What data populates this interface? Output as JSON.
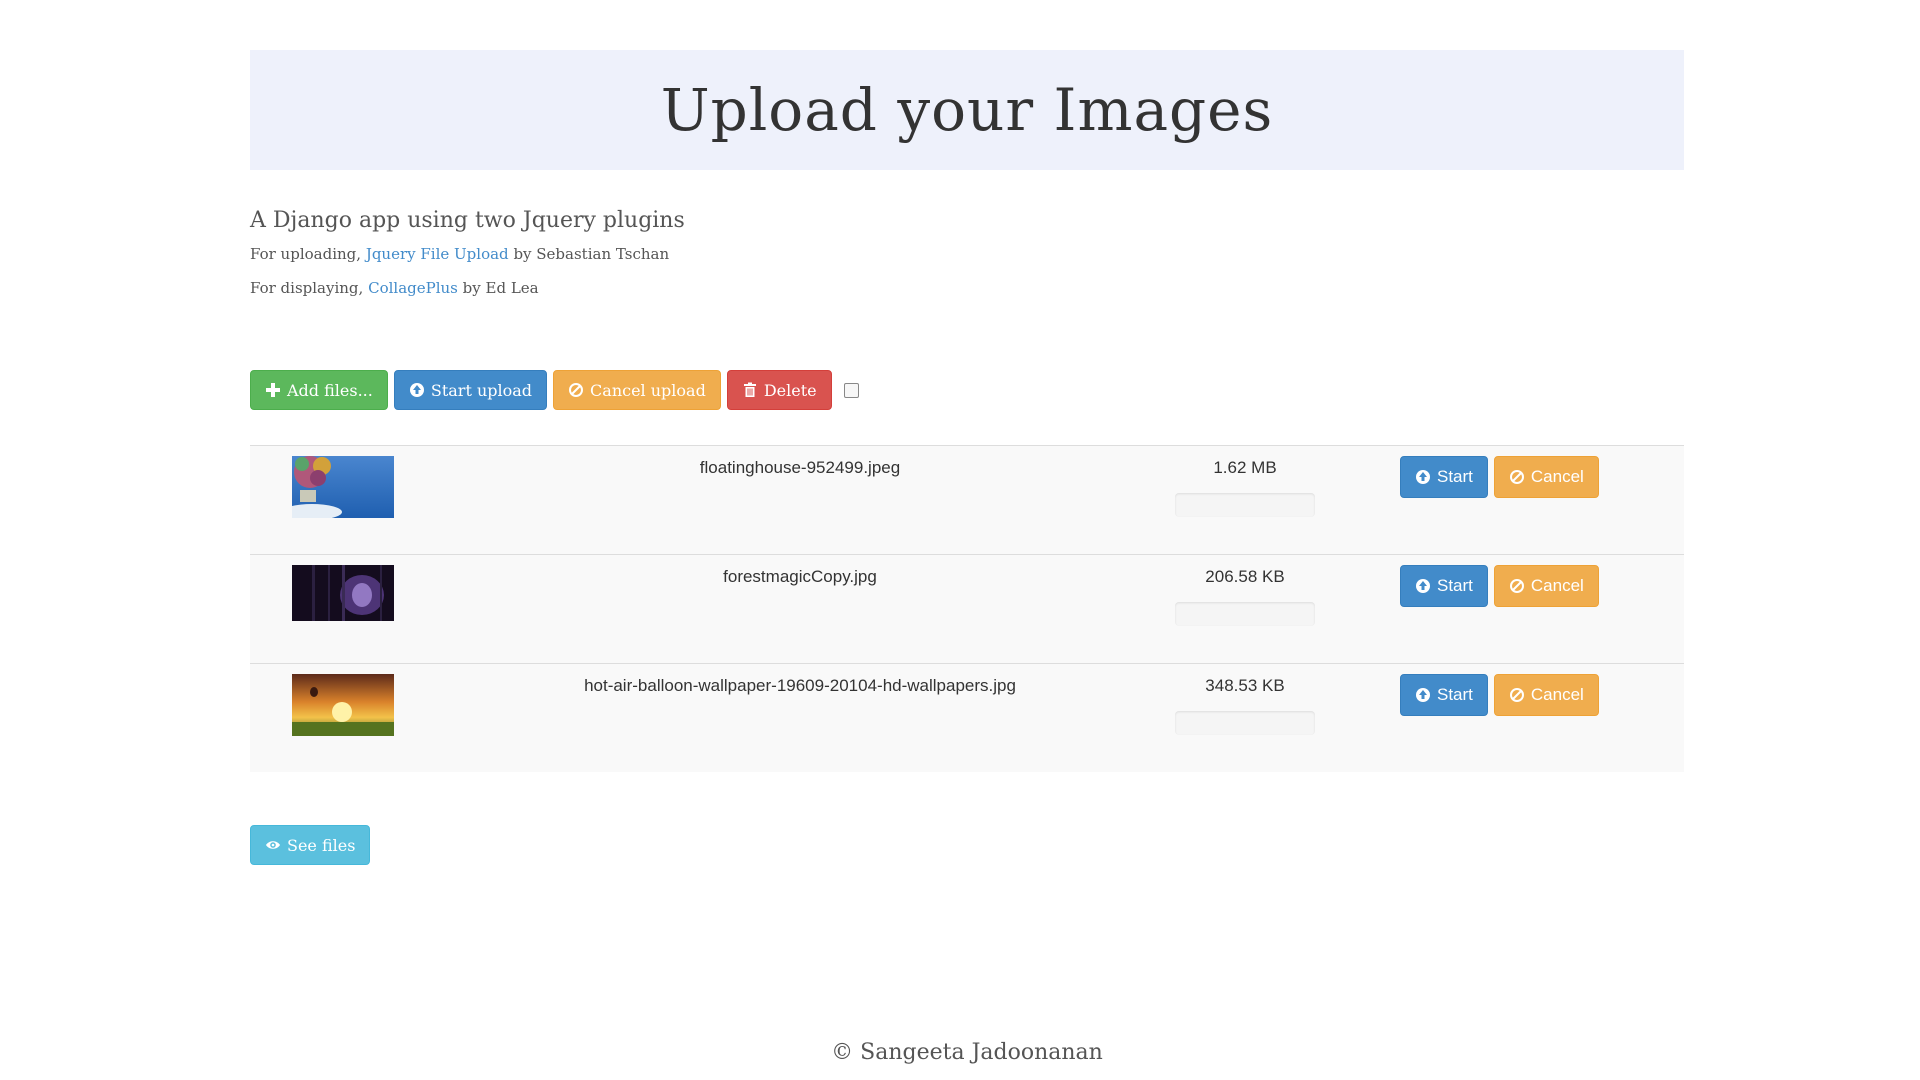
{
  "header": {
    "title": "Upload your Images"
  },
  "intro": {
    "heading": "A Django app using two Jquery plugins",
    "line1": {
      "prefix": "For uploading,",
      "link": "Jquery File Upload",
      "suffix": "by Sebastian Tschan"
    },
    "line2": {
      "prefix": "For displaying,",
      "link": "CollagePlus",
      "suffix": "by Ed Lea"
    }
  },
  "toolbar": {
    "add_label": "Add files...",
    "start_label": "Start upload",
    "cancel_label": "Cancel upload",
    "delete_label": "Delete"
  },
  "files": [
    {
      "name": "floatinghouse-952499.jpeg",
      "size": "1.62 MB",
      "progress": 0,
      "start_label": "Start",
      "cancel_label": "Cancel"
    },
    {
      "name": "forestmagicCopy.jpg",
      "size": "206.58 KB",
      "progress": 0,
      "start_label": "Start",
      "cancel_label": "Cancel"
    },
    {
      "name": "hot-air-balloon-wallpaper-19609-20104-hd-wallpapers.jpg",
      "size": "348.53 KB",
      "progress": 0,
      "start_label": "Start",
      "cancel_label": "Cancel"
    }
  ],
  "see_files_label": "See files",
  "footer": {
    "text": "© Sangeeta Jadoonanan"
  },
  "colors": {
    "jumbotron_bg": "#eef1fb",
    "success": "#5cb85c",
    "primary": "#428bca",
    "warning": "#f0ad4e",
    "danger": "#d9534f",
    "info": "#5bc0de"
  },
  "icons": {
    "add": "plus-icon",
    "start": "upload-circle-icon",
    "cancel": "ban-icon",
    "delete": "trash-icon",
    "see": "eye-icon"
  }
}
